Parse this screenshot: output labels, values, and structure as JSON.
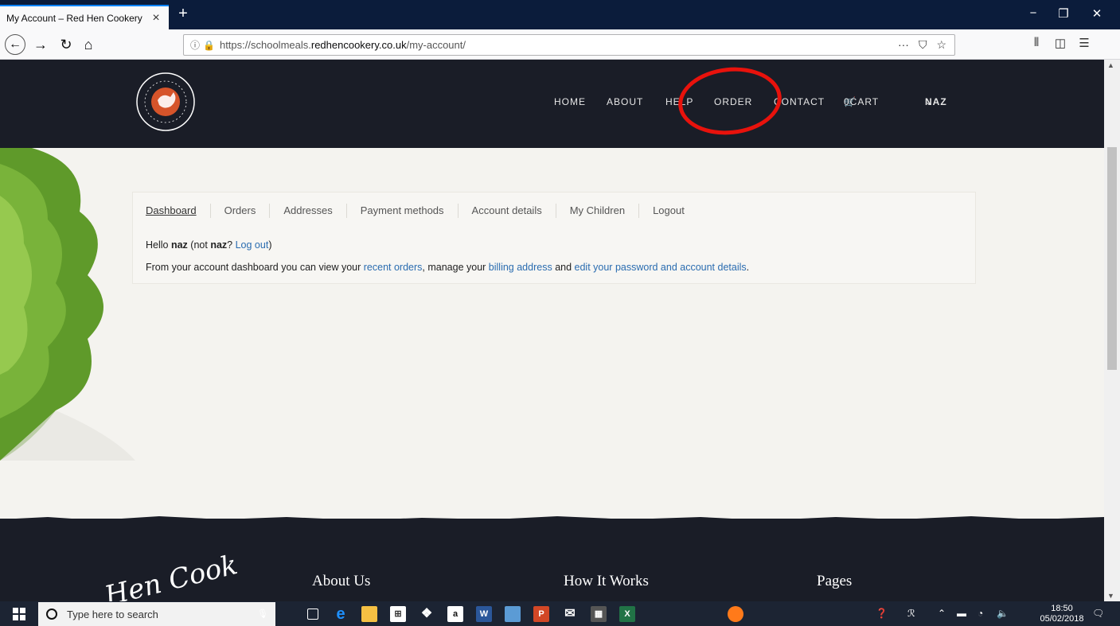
{
  "browser": {
    "tab_title": "My Account – Red Hen Cookery",
    "tab_close": "×",
    "new_tab": "+",
    "url_prefix": "https://schoolmeals.",
    "url_domain": "redhencookery.co.uk",
    "url_suffix": "/my-account/",
    "url_more": "···"
  },
  "site": {
    "nav": [
      "HOME",
      "ABOUT",
      "HELP",
      "ORDER",
      "CONTACT",
      "0CART",
      "NAZ"
    ],
    "nav_chevron": "⌄"
  },
  "account": {
    "tabs": [
      "Dashboard",
      "Orders",
      "Addresses",
      "Payment methods",
      "Account details",
      "My Children",
      "Logout"
    ],
    "greeting_hello": "Hello ",
    "greeting_user": "naz",
    "greeting_not": " (not ",
    "greeting_user2": "naz",
    "greeting_q": "? ",
    "greeting_logout": "Log out",
    "greeting_close": ")",
    "desc_1": "From your account dashboard you can view your ",
    "desc_link1": "recent orders",
    "desc_2": ", manage your ",
    "desc_link2": "billing address",
    "desc_3": " and ",
    "desc_link3": "edit your password and account details",
    "desc_4": "."
  },
  "footer": {
    "logo_text": "Hen Cook",
    "cols": [
      "About Us",
      "How It Works",
      "Pages"
    ]
  },
  "taskbar": {
    "search_placeholder": "Type here to search",
    "time": "18:50",
    "date": "05/02/2018"
  },
  "colors": {
    "header_bg": "#1a1d27",
    "link": "#2a6cb0",
    "highlight": "#e8120c"
  }
}
